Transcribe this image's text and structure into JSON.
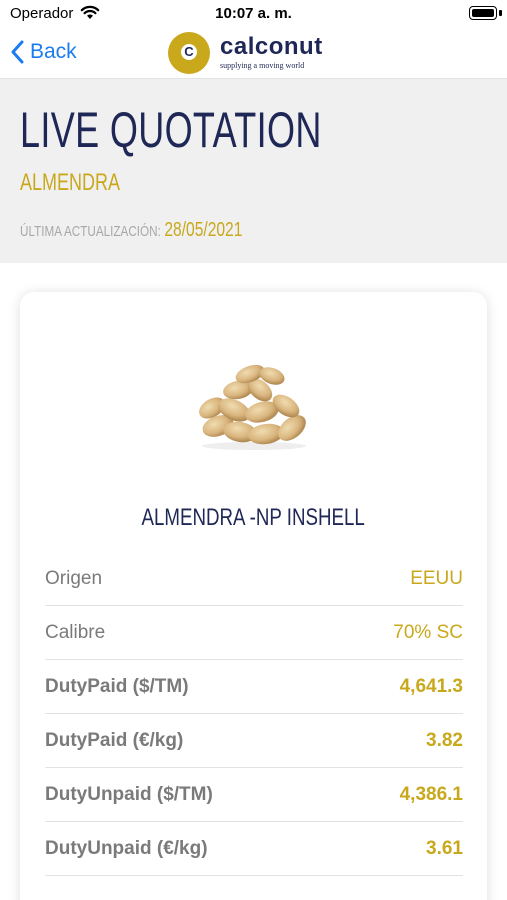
{
  "status_bar": {
    "carrier": "Operador",
    "time": "10:07 a. m."
  },
  "nav": {
    "back_label": "Back",
    "logo_letter": "C",
    "logo_name": "calconut",
    "logo_tagline": "supplying a moving world"
  },
  "header": {
    "title": "LIVE QUOTATION",
    "subtitle": "ALMENDRA",
    "update_label": "ÚLTIMA ACTUALIZACIÓN:",
    "update_date": "28/05/2021"
  },
  "product": {
    "name": "ALMENDRA -NP INSHELL",
    "rows": [
      {
        "label": "Origen",
        "value": "EEUU"
      },
      {
        "label": "Calibre",
        "value": "70% SC"
      },
      {
        "label": "DutyPaid ($/TM)",
        "value": "4,641.3"
      },
      {
        "label": "DutyPaid (€/kg)",
        "value": "3.82"
      },
      {
        "label": "DutyUnpaid ($/TM)",
        "value": "4,386.1"
      },
      {
        "label": "DutyUnpaid (€/kg)",
        "value": "3.61"
      }
    ]
  },
  "colors": {
    "navy": "#1e2756",
    "gold": "#c9a81c",
    "ios_blue": "#1a7cf0",
    "header_bg": "#f0f0f0"
  },
  "icons": [
    "wifi-icon",
    "battery-icon",
    "chevron-left-icon",
    "calconut-logo",
    "almond-image"
  ]
}
